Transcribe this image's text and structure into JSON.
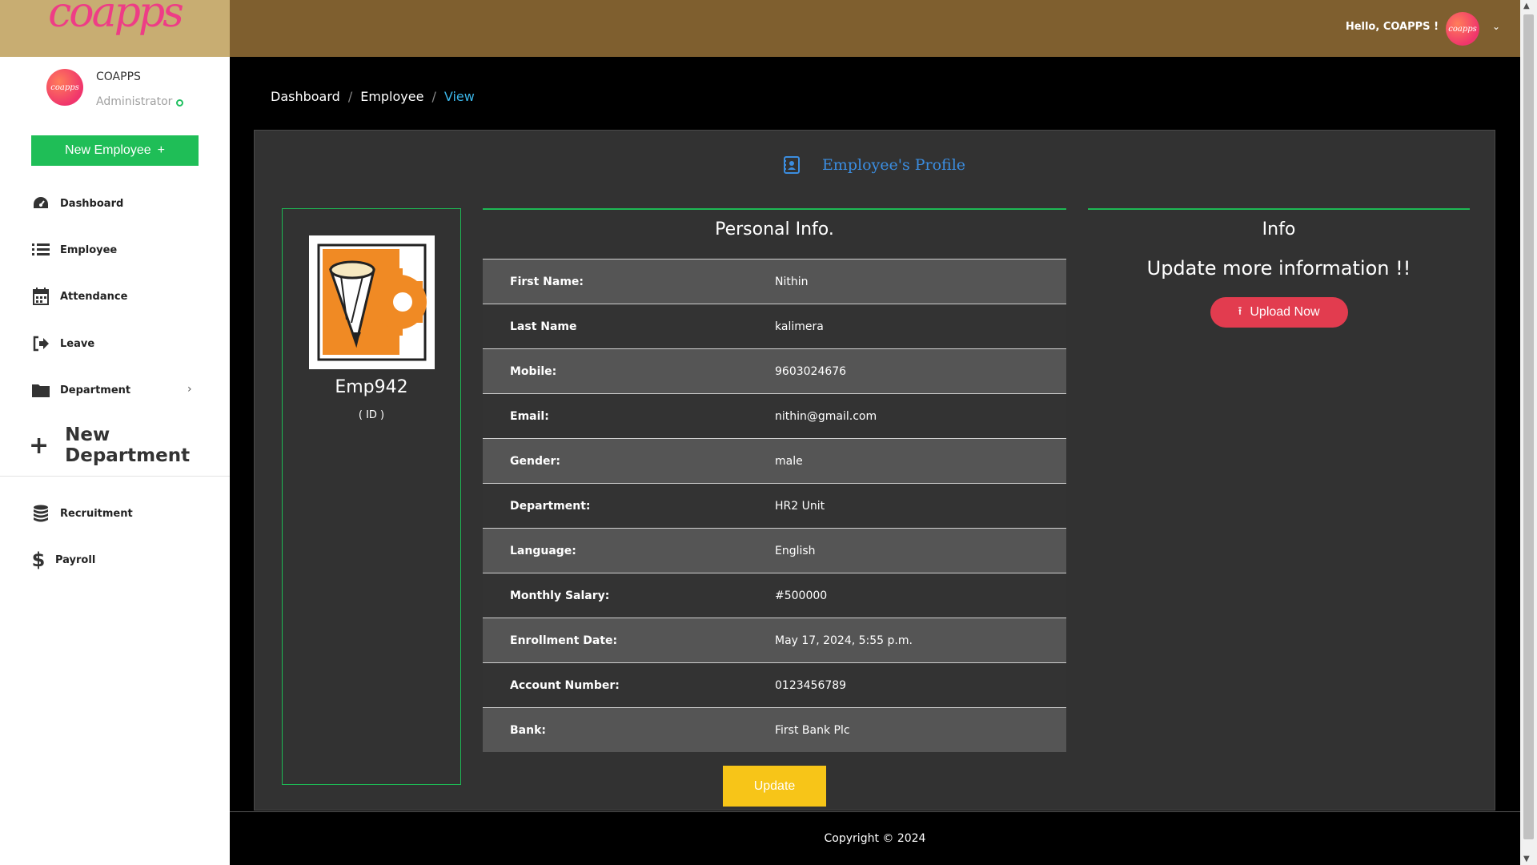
{
  "brand": {
    "logo_text": "coapps",
    "accent": "#ee3d86",
    "brand_bg": "#c8ad72"
  },
  "user": {
    "name": "COAPPS",
    "role": "Administrator",
    "avatar_text": "coapps"
  },
  "sidebar": {
    "new_employee_label": "New Employee",
    "new_employee_icon": "plus",
    "items": [
      {
        "label": "Dashboard",
        "icon": "dashboard-gauge-icon"
      },
      {
        "label": "Employee",
        "icon": "list-icon"
      },
      {
        "label": "Attendance",
        "icon": "calendar-icon"
      },
      {
        "label": "Leave",
        "icon": "sign-out-icon"
      },
      {
        "label": "Department",
        "icon": "folder-icon"
      }
    ],
    "new_department_label": "New Department",
    "secondary_items": [
      {
        "label": "Recruitment",
        "icon": "database-icon"
      },
      {
        "label": "Payroll",
        "icon": "dollar-icon"
      }
    ]
  },
  "header": {
    "greeting": "Hello, COAPPS !",
    "header_bg": "#7f5f2f"
  },
  "breadcrumb": [
    "Dashboard",
    "Employee",
    "View"
  ],
  "profile": {
    "title": "Employee's Profile",
    "employee_id": "Emp942",
    "id_label": "( ID )",
    "personal_title": "Personal Info.",
    "fields": [
      {
        "label": "First Name:",
        "value": "Nithin"
      },
      {
        "label": "Last Name",
        "value": "kalimera"
      },
      {
        "label": "Mobile:",
        "value": "9603024676"
      },
      {
        "label": "Email:",
        "value": "nithin@gmail.com"
      },
      {
        "label": "Gender:",
        "value": "male"
      },
      {
        "label": "Department:",
        "value": "HR2 Unit"
      },
      {
        "label": "Language:",
        "value": "English"
      },
      {
        "label": "Monthly Salary:",
        "value": "#500000"
      },
      {
        "label": "Enrollment Date:",
        "value": "May 17, 2024, 5:55 p.m."
      },
      {
        "label": "Account Number:",
        "value": "0123456789"
      },
      {
        "label": "Bank:",
        "value": "First Bank Plc"
      }
    ],
    "update_label": "Update"
  },
  "info": {
    "title": "Info",
    "subtitle": "Update more information !!",
    "upload_label": "Upload Now"
  },
  "footer": {
    "copyright": "Copyright © 2024"
  },
  "colors": {
    "green": "#1db954",
    "update_yellow": "#f7c518",
    "upload_red": "#e23c4f",
    "link_blue": "#3bb4e6"
  }
}
